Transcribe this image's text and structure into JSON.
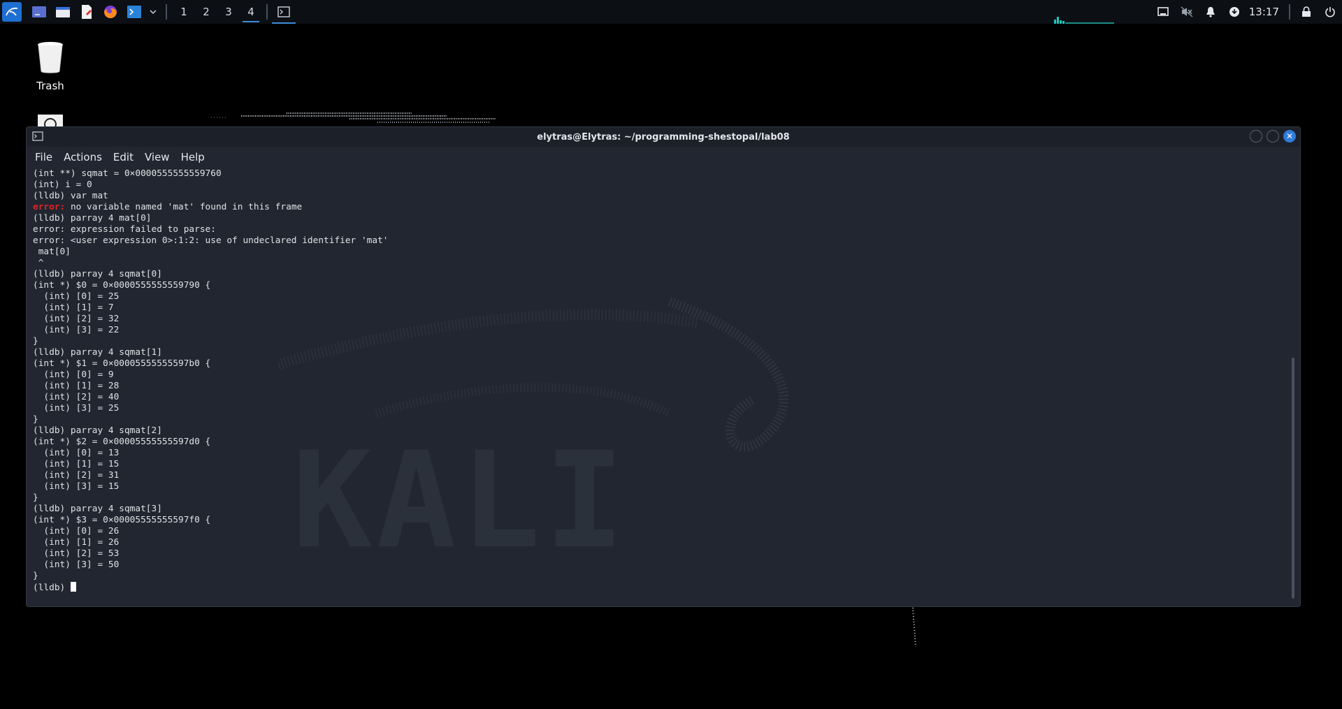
{
  "panel": {
    "workspaces": [
      "1",
      "2",
      "3",
      "4"
    ],
    "active_workspace": "4",
    "clock": "13:17",
    "icons": [
      "kali-menu-icon",
      "show-desktop-icon",
      "file-manager-icon",
      "text-editor-icon",
      "firefox-icon",
      "terminal-icon",
      "chevron-down-icon"
    ],
    "tray_icons": [
      "screen-icon",
      "volume-muted-icon",
      "bell-icon",
      "update-icon",
      "lock-icon",
      "power-icon"
    ]
  },
  "desktop": {
    "trash_label": "Trash"
  },
  "window": {
    "title": "elytras@Elytras: ~/programming-shestopal/lab08",
    "menu": [
      "File",
      "Actions",
      "Edit",
      "View",
      "Help"
    ]
  },
  "terminal": {
    "lines": [
      "(int **) sqmat = 0×0000555555559760",
      "(int) i = 0",
      "(lldb) var mat",
      "",
      "(lldb) parray 4 mat[0]",
      "error: expression failed to parse:",
      "error: <user expression 0>:1:2: use of undeclared identifier 'mat'",
      " mat[0]",
      " ^",
      "(lldb) parray 4 sqmat[0]",
      "(int *) $0 = 0×0000555555559790 {",
      "  (int) [0] = 25",
      "  (int) [1] = 7",
      "  (int) [2] = 32",
      "  (int) [3] = 22",
      "}",
      "(lldb) parray 4 sqmat[1]",
      "(int *) $1 = 0×00005555555597b0 {",
      "  (int) [0] = 9",
      "  (int) [1] = 28",
      "  (int) [2] = 40",
      "  (int) [3] = 25",
      "}",
      "(lldb) parray 4 sqmat[2]",
      "(int *) $2 = 0×00005555555597d0 {",
      "  (int) [0] = 13",
      "  (int) [1] = 15",
      "  (int) [2] = 31",
      "  (int) [3] = 15",
      "}",
      "(lldb) parray 4 sqmat[3]",
      "(int *) $3 = 0×00005555555597f0 {",
      "  (int) [0] = 26",
      "  (int) [1] = 26",
      "  (int) [2] = 53",
      "  (int) [3] = 50",
      "}"
    ],
    "error_label": "error:",
    "error_rest": " no variable named 'mat' found in this frame",
    "prompt": "(lldb) "
  },
  "colors": {
    "accent": "#3d8bd9",
    "error": "#e02424",
    "terminal_bg": "#222630"
  }
}
